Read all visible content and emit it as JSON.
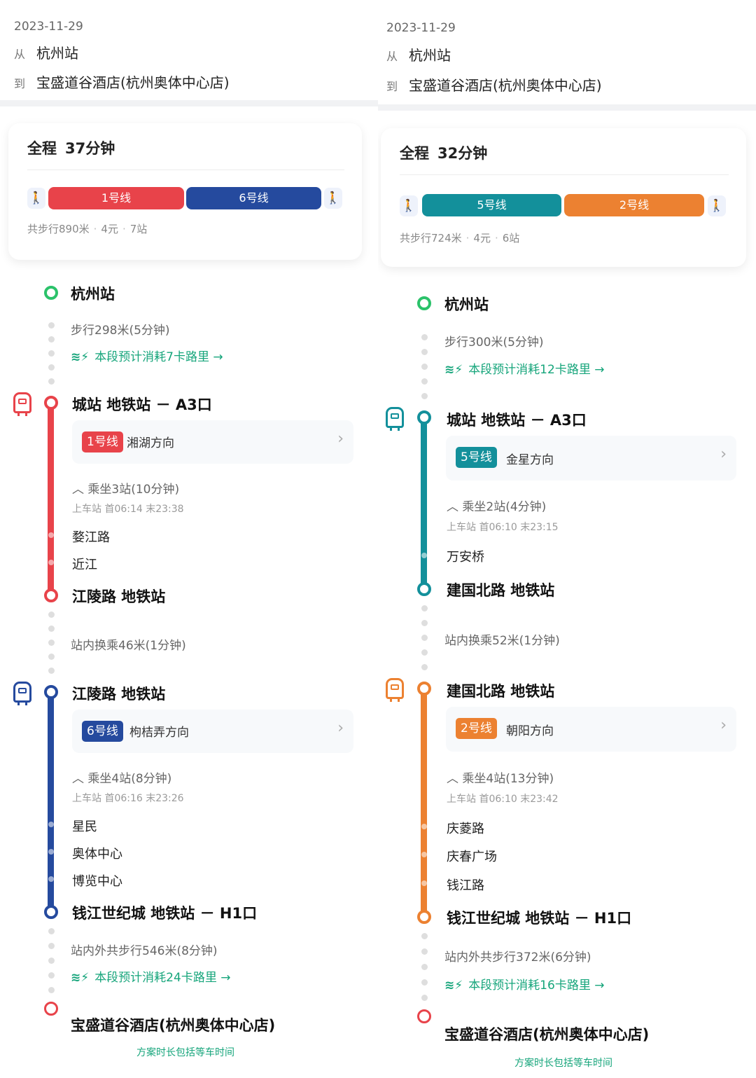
{
  "routes": [
    {
      "header": {
        "date": "2023-11-29",
        "from_key": "从",
        "from": "杭州站",
        "to_key": "到",
        "to": "宝盛道谷酒店(杭州奥体中心店)"
      },
      "summary": {
        "label": "全程",
        "total": "37分钟",
        "walk": "共步行890米",
        "fare": "4元",
        "stops": "7站",
        "lines": [
          {
            "name": "1号线",
            "color": "#e8434a"
          },
          {
            "name": "6号线",
            "color": "#254a9e"
          }
        ]
      },
      "origin": "杭州站",
      "walk_in": {
        "text": "步行298米(5分钟)",
        "calorie": "本段预计消耗7卡路里 →"
      },
      "leg1": {
        "station": "城站 地铁站 － A3口",
        "badge": "1号线",
        "direction": "湘湖方向",
        "ride": "乘坐3站(10分钟)",
        "times": "上车站 首06:14  末23:38",
        "stops": [
          "婺江路",
          "近江"
        ],
        "end": "江陵路 地铁站",
        "color": "#e8434a"
      },
      "transfer": "站内换乘46米(1分钟)",
      "leg2": {
        "station": "江陵路 地铁站",
        "badge": "6号线",
        "direction": "枸桔弄方向",
        "ride": "乘坐4站(8分钟)",
        "times": "上车站 首06:16  末23:26",
        "stops": [
          "星民",
          "奥体中心",
          "博览中心"
        ],
        "end": "钱江世纪城 地铁站 － H1口",
        "color": "#254a9e"
      },
      "walk_out": {
        "text": "站内外共步行546米(8分钟)",
        "calorie": "本段预计消耗24卡路里 →"
      },
      "destination": "宝盛道谷酒店(杭州奥体中心店)",
      "footnote": "方案时长包括等车时间"
    },
    {
      "header": {
        "date": "2023-11-29",
        "from_key": "从",
        "from": "杭州站",
        "to_key": "到",
        "to": "宝盛道谷酒店(杭州奥体中心店)"
      },
      "summary": {
        "label": "全程",
        "total": "32分钟",
        "walk": "共步行724米",
        "fare": "4元",
        "stops": "6站",
        "lines": [
          {
            "name": "5号线",
            "color": "#13909b"
          },
          {
            "name": "2号线",
            "color": "#ec8131"
          }
        ]
      },
      "origin": "杭州站",
      "walk_in": {
        "text": "步行300米(5分钟)",
        "calorie": "本段预计消耗12卡路里 →"
      },
      "leg1": {
        "station": "城站 地铁站 － A3口",
        "badge": "5号线",
        "direction": "金星方向",
        "ride": "乘坐2站(4分钟)",
        "times": "上车站 首06:10  末23:15",
        "stops": [
          "万安桥"
        ],
        "end": "建国北路 地铁站",
        "color": "#13909b"
      },
      "transfer": "站内换乘52米(1分钟)",
      "leg2": {
        "station": "建国北路 地铁站",
        "badge": "2号线",
        "direction": "朝阳方向",
        "ride": "乘坐4站(13分钟)",
        "times": "上车站 首06:10  末23:42",
        "stops": [
          "庆菱路",
          "庆春广场",
          "钱江路"
        ],
        "end": "钱江世纪城 地铁站 － H1口",
        "color": "#ec8131"
      },
      "walk_out": {
        "text": "站内外共步行372米(6分钟)",
        "calorie": "本段预计消耗16卡路里 →"
      },
      "destination": "宝盛道谷酒店(杭州奥体中心店)",
      "footnote": "方案时长包括等车时间"
    }
  ],
  "colors": {
    "origin": "#2bc26a",
    "destination": "#e8434a",
    "calorie": "#16a57b",
    "walk_icon": "#1d67d9"
  },
  "icons": {
    "walk": "walking-person-icon",
    "metro": "metro-train-icon",
    "calorie": "running-leaf-icon",
    "chevron": "chevron-right-icon"
  }
}
